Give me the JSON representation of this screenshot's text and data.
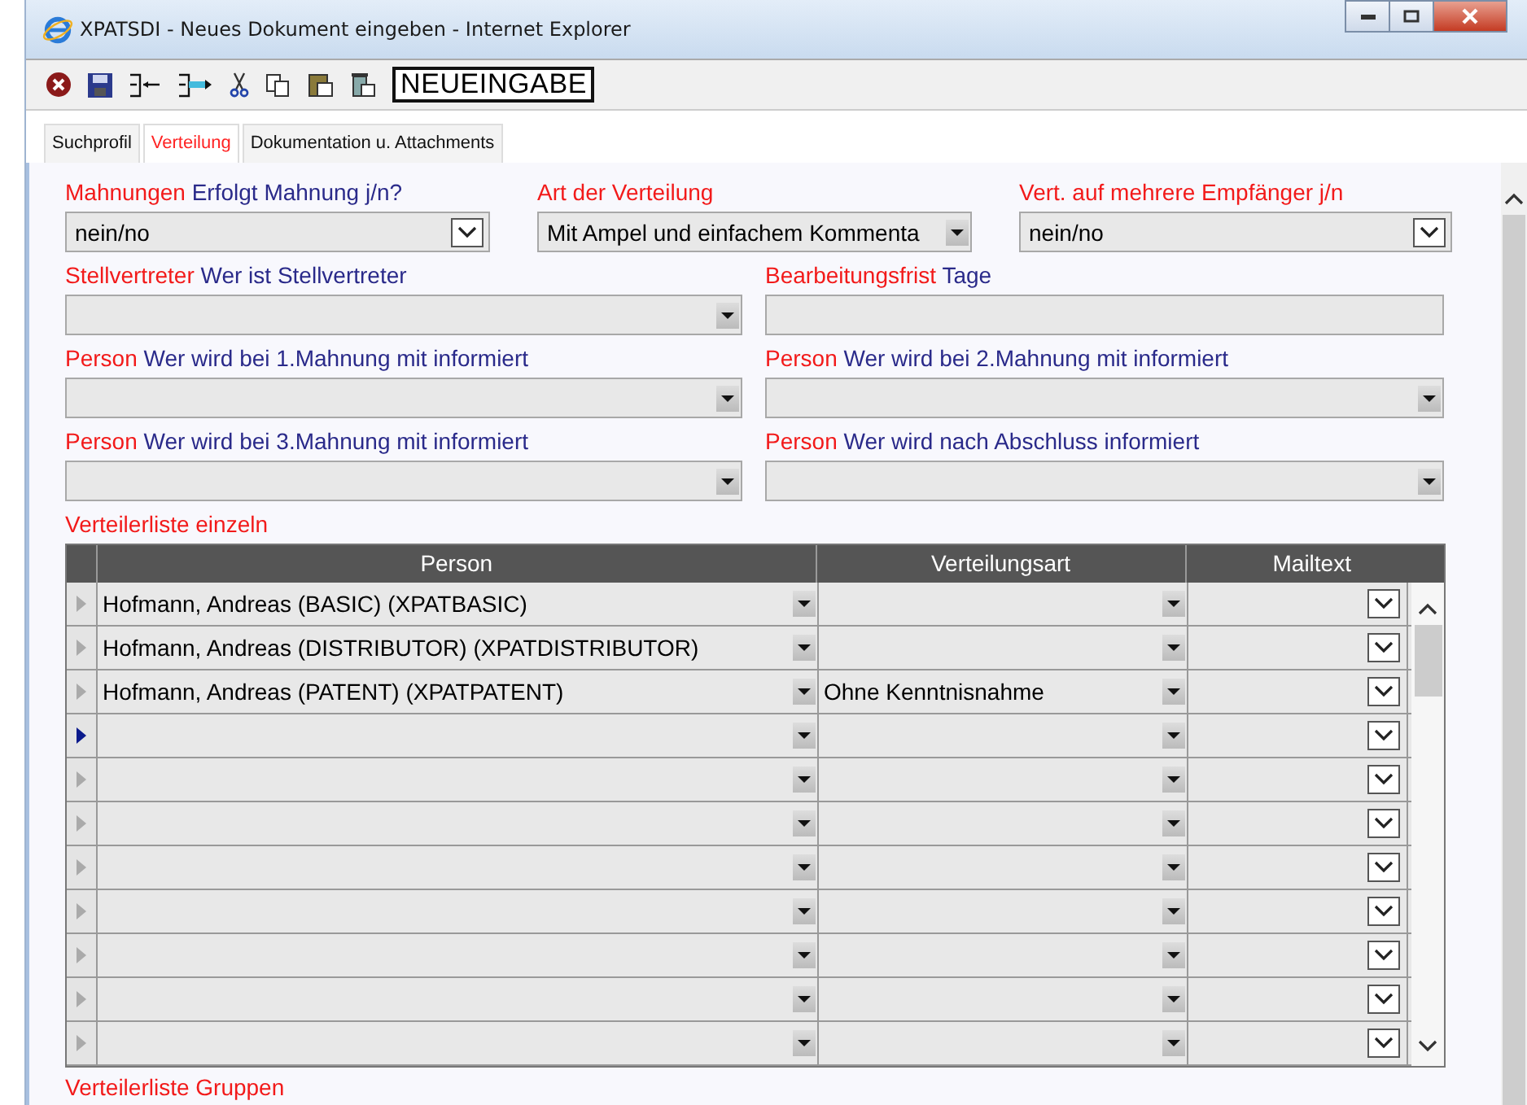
{
  "window": {
    "title": "XPATSDI - Neues Dokument eingeben - Internet Explorer"
  },
  "toolbar": {
    "mode": "NEUEINGABE"
  },
  "tabs": [
    {
      "label": "Suchprofil",
      "selected": false
    },
    {
      "label": "Verteilung",
      "selected": true
    },
    {
      "label": "Dokumentation u. Attachments",
      "selected": false
    }
  ],
  "field_rows": [
    {
      "fields": [
        {
          "label": "Mahnungen",
          "hint": "Erfolgt Mahnung j/n?",
          "kind": "dropdown",
          "value": "nein/no"
        },
        {
          "label": "Art der Verteilung",
          "kind": "combo",
          "value": "Mit Ampel und einfachem Kommenta"
        },
        {
          "label": "Vert. auf mehrere Empfänger j/n",
          "kind": "dropdown",
          "value": "nein/no"
        }
      ]
    },
    {
      "fields": [
        {
          "label": "Stellvertreter",
          "hint": "Wer ist Stellvertreter",
          "kind": "combo"
        },
        {
          "label": "Bearbeitungsfrist",
          "hint": "Tage",
          "kind": "text"
        }
      ]
    },
    {
      "fields": [
        {
          "label": "Person",
          "hint": "Wer wird bei 1.Mahnung mit informiert",
          "kind": "combo"
        },
        {
          "label": "Person",
          "hint": "Wer wird bei 2.Mahnung mit informiert",
          "kind": "combo"
        }
      ]
    },
    {
      "fields": [
        {
          "label": "Person",
          "hint": "Wer wird bei 3.Mahnung mit informiert",
          "kind": "combo"
        },
        {
          "label": "Person",
          "hint": "Wer wird nach Abschluss informiert",
          "kind": "combo"
        }
      ]
    }
  ],
  "list_single": {
    "title": "Verteilerliste einzeln",
    "columns": [
      "Person",
      "Verteilungsart",
      "Mailtext"
    ],
    "rows": [
      {
        "person": "Hofmann, Andreas (BASIC) (XPATBASIC)",
        "current": false
      },
      {
        "person": "Hofmann, Andreas (DISTRIBUTOR) (XPATDISTRIBUTOR)",
        "current": false
      },
      {
        "person": "Hofmann, Andreas (PATENT) (XPATPATENT)",
        "type": "Ohne Kenntnisnahme",
        "current": false
      },
      {
        "current": true
      },
      {
        "current": false
      },
      {
        "current": false
      },
      {
        "current": false
      },
      {
        "current": false
      },
      {
        "current": false
      },
      {
        "current": false
      },
      {
        "current": false
      }
    ]
  },
  "list_groups": {
    "title": "Verteilerliste Gruppen"
  }
}
